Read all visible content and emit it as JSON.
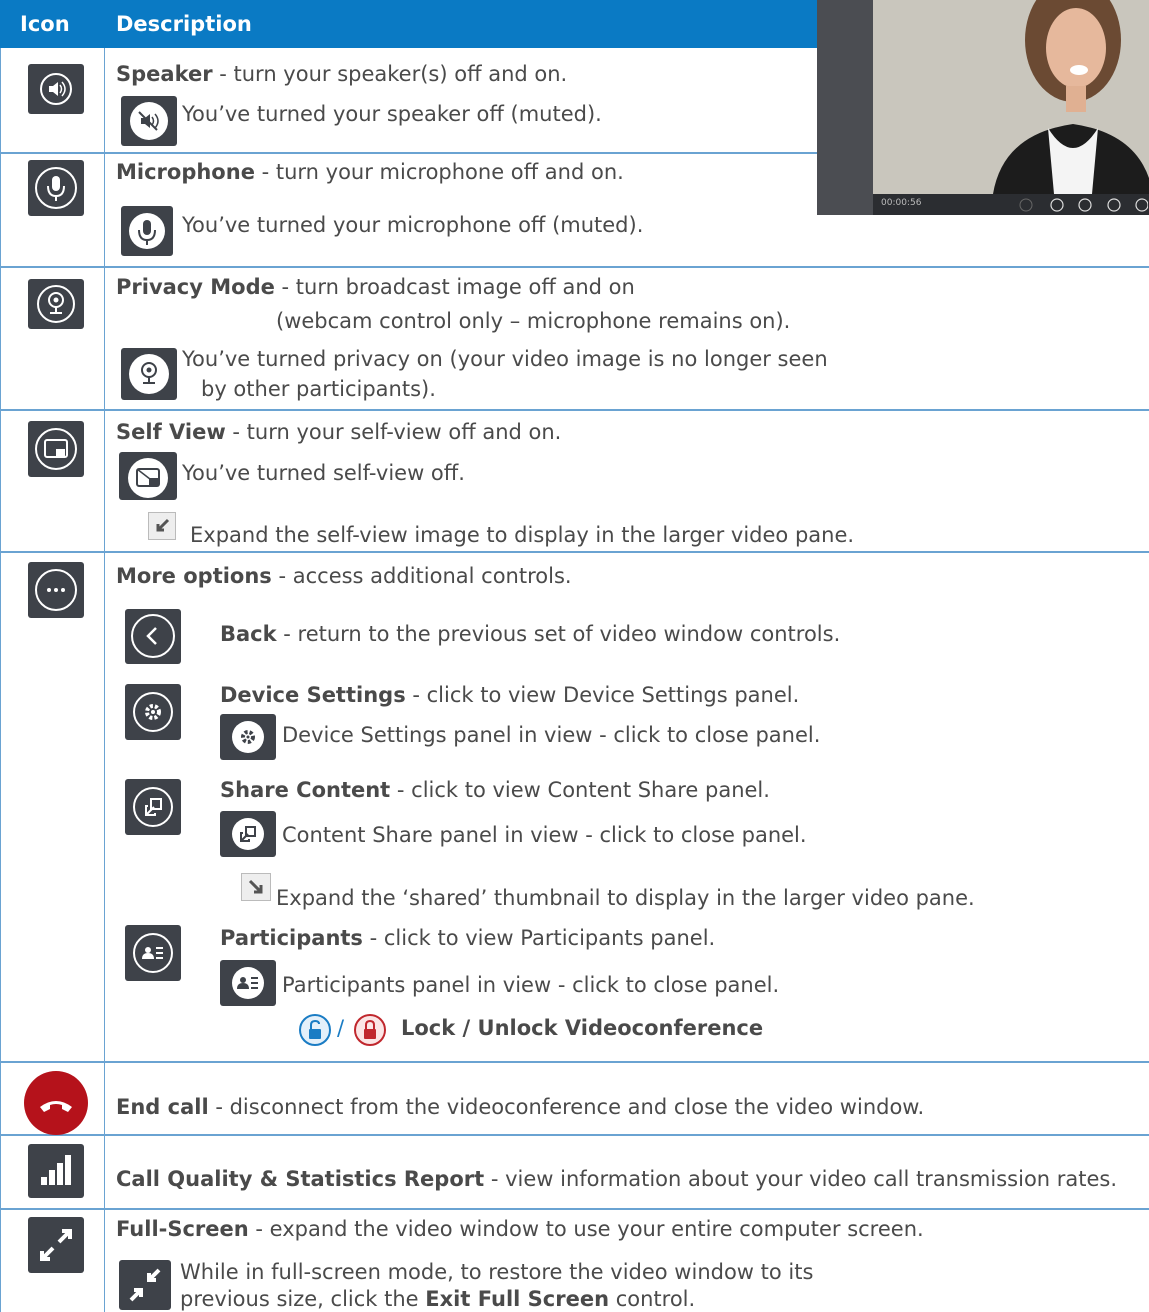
{
  "header": {
    "col_icon": "Icon",
    "col_description": "Description"
  },
  "speaker": {
    "title": "Speaker",
    "desc": " - turn your speaker(s) off and on.",
    "muted": "You’ve turned your speaker off (muted)."
  },
  "microphone": {
    "title": "Microphone",
    "desc": " - turn your microphone off and on.",
    "muted": "You’ve turned your microphone off (muted)."
  },
  "privacy": {
    "title": "Privacy Mode",
    "desc": " - turn broadcast image off and on",
    "desc2": "(webcam control only – microphone remains on).",
    "on1": "You’ve turned privacy on (your video image is no longer seen",
    "on2": "by other participants)."
  },
  "selfview": {
    "title": "Self View",
    "desc": " - turn your self-view off and on.",
    "off": "You’ve turned self-view off.",
    "expand": "Expand the self-view image to display in the larger video pane."
  },
  "more": {
    "title": "More options",
    "desc": " - access additional controls.",
    "back_title": "Back",
    "back_desc": " - return to the previous set of video window controls.",
    "device_title": "Device Settings",
    "device_desc": " - click to view Device Settings panel.",
    "device_open": "Device Settings panel in view - click to close panel.",
    "share_title": "Share Content",
    "share_desc": " - click to view Content Share panel.",
    "share_open": "Content Share panel in view - click to close panel.",
    "share_expand": "Expand the ‘shared’ thumbnail to display in the larger video pane.",
    "part_title": "Participants",
    "part_desc": " - click to view Participants panel.",
    "part_open": "Participants panel in view - click to close panel.",
    "lock_sep": "/",
    "lock_label": "Lock / Unlock Videoconference"
  },
  "endcall": {
    "title": "End call",
    "desc": " - disconnect from the videoconference and close the video window."
  },
  "quality": {
    "title": "Call Quality & Statistics Report",
    "desc": " - view information about your video call transmission rates."
  },
  "fullscreen": {
    "title": "Full-Screen",
    "desc": " - expand the video window to use your entire computer screen.",
    "exit1": "While in full-screen mode, to restore the video window to its",
    "exit2a": "previous size, click the ",
    "exit2b": "Exit Full Screen",
    "exit2c": " control."
  },
  "video": {
    "timer": "00:00:56"
  },
  "colors": {
    "header": "#0a7ac4",
    "icon_bg": "#3e4249",
    "end_call": "#b5121b",
    "lock_blue": "#1a7cc4",
    "lock_red": "#c0272d"
  }
}
